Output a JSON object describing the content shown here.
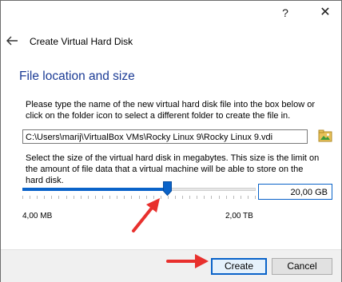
{
  "titlebar": {
    "help_label": "?",
    "close_label": "✕"
  },
  "header": {
    "title": "Create Virtual Hard Disk",
    "back_icon": "arrow-left-icon"
  },
  "section": {
    "title": "File location and size"
  },
  "location": {
    "instructions": "Please type the name of the new virtual hard disk file into the box below or click on the folder icon to select a different folder to create the file in.",
    "path_value": "C:\\Users\\marij\\VirtualBox VMs\\Rocky Linux 9\\Rocky Linux 9.vdi",
    "folder_icon": "folder-open-icon"
  },
  "size": {
    "instructions": "Select the size of the virtual hard disk in megabytes. This size is the limit on the amount of file data that a virtual machine will be able to store on the hard disk.",
    "value": "20,00 GB",
    "slider_fraction": 0.62,
    "min_label": "4,00 MB",
    "max_label": "2,00 TB"
  },
  "footer": {
    "create_label": "Create",
    "cancel_label": "Cancel"
  },
  "colors": {
    "accent": "#0a63c9",
    "section_title": "#1b3b95",
    "annotation_arrow": "#e8302d"
  }
}
